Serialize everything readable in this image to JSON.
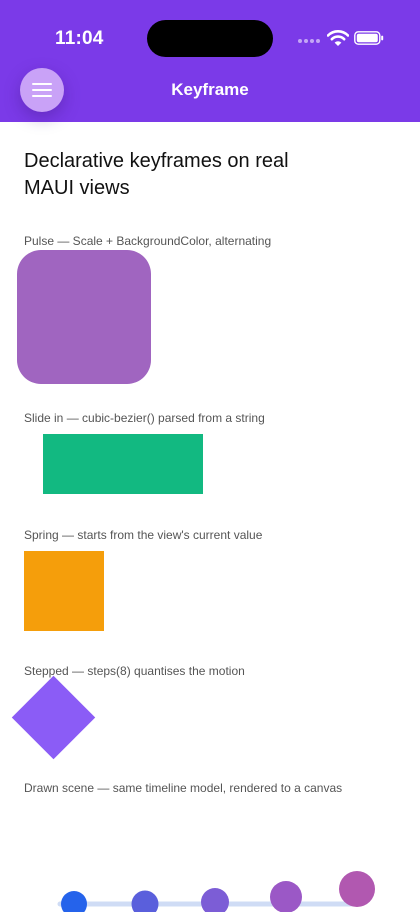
{
  "status_bar": {
    "time": "11:04",
    "icons": [
      "signal-dots-icon",
      "wifi-icon",
      "battery-icon"
    ]
  },
  "header": {
    "title": "Keyframe",
    "menu_icon": "hamburger-menu-icon",
    "background_color": "#7b3ae8"
  },
  "content": {
    "heading": "Declarative keyframes on real MAUI views",
    "demos": [
      {
        "caption": "Pulse — Scale + BackgroundColor, alternating",
        "color": "#a065c0"
      },
      {
        "caption": "Slide in — cubic-bezier() parsed from a string",
        "color": "#12b981"
      },
      {
        "caption": "Spring — starts from the view's current value",
        "color": "#f59e0b"
      },
      {
        "caption": "Stepped — steps(8) quantises the motion",
        "color": "#8b5cf6"
      },
      {
        "caption": "Drawn scene — same timeline model, rendered to a canvas"
      }
    ],
    "scene_dot_colors": [
      "#2563eb",
      "#5a5fdc",
      "#7c5dd6",
      "#9b58c6",
      "#b158b0"
    ]
  }
}
